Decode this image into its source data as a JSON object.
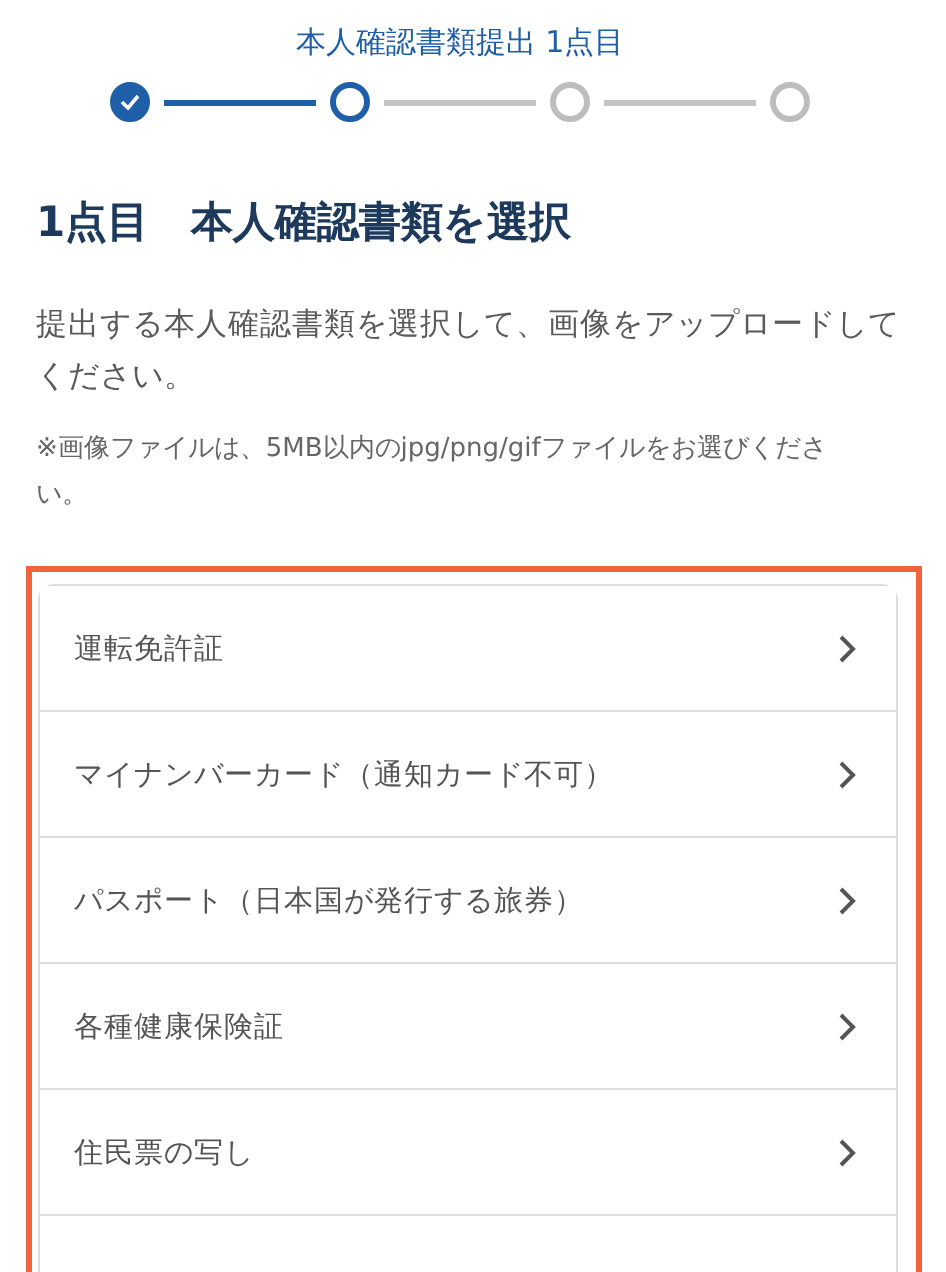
{
  "stepper": {
    "label": "本人確認書類提出 1点目",
    "steps": [
      {
        "completed": true,
        "selected": false
      },
      {
        "completed": false,
        "selected": true
      },
      {
        "completed": false,
        "selected": false
      },
      {
        "completed": false,
        "selected": false
      }
    ]
  },
  "heading": "1点目　本人確認書類を選択",
  "description": "提出する本人確認書類を選択して、画像をアップロードしてください。",
  "note": "※画像ファイルは、5MB以内のjpg/png/gifファイルをお選びください。",
  "documents": [
    {
      "label": "運転免許証"
    },
    {
      "label": "マイナンバーカード（通知カード不可）"
    },
    {
      "label": "パスポート（日本国が発行する旅券）"
    },
    {
      "label": "各種健康保険証"
    },
    {
      "label": "住民票の写し"
    }
  ]
}
